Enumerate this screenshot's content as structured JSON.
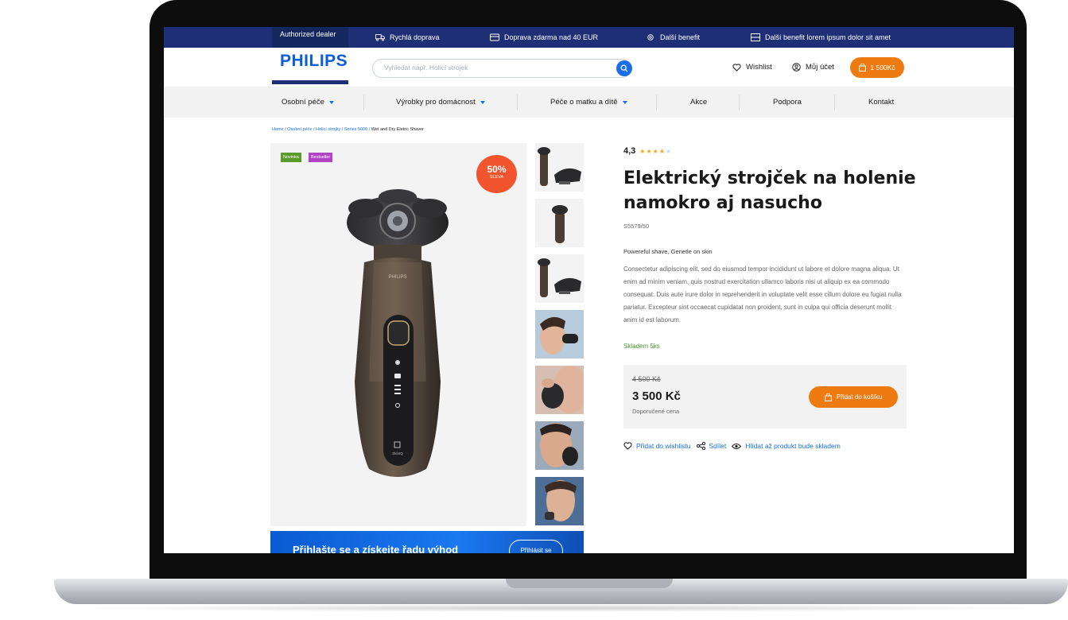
{
  "topbar": {
    "dealer": "Authorized dealer",
    "items": [
      "Rychlá doprava",
      "Doprava zdarma nad 40 EUR",
      "Další benefit",
      "Další benefit lorem ipsum dolor sit amet"
    ]
  },
  "header": {
    "logo": "PHILIPS",
    "search_placeholder": "Vyhledat např. Holicí strojek",
    "wishlist": "Wishlist",
    "account": "Můj účet",
    "cart": "1 500Kč"
  },
  "nav": [
    "Osobní péče",
    "Výrobky pro domácnost",
    "Péče o matku a dítě",
    "Akce",
    "Podpora",
    "Kontakt"
  ],
  "breadcrumb": {
    "links": [
      "Home",
      "Osobní péče",
      "Holicí strojky",
      "Series 5000"
    ],
    "current": "Wet and Dry Eletric Shaver"
  },
  "product": {
    "badges": [
      "Novinka",
      "Bestseller"
    ],
    "discount_pct": "50%",
    "discount_label": "SLEVA",
    "rating": "4,3",
    "rating_value": 4.3,
    "stars": "★★★★",
    "star_empty": "★",
    "title": "Elektrický strojček na holenie namokro aj nasucho",
    "sku": "S5579/50",
    "subtitle": "Powereful shave, Genetle on skin",
    "description": "Consectetur adipiscing elit, sed do eiusmod tempor incididunt ut labore et dolore magna aliqua. Ut enim ad minim veniam, quis nostrud exercitation ullamco laboris nisi ut aliquip ex ea commodo consequat. Duis aute irure dolor in reprehenderit in voluptate velit esse cillum dolore eu fugiat nulla pariatur. Excepteur sint occaecat cupidatat non proident, sunt in culpa qui officia deserunt mollit anim id est laborum.",
    "stock": "Skladem 5ks",
    "old_price": "4 500 Kč",
    "price": "3 500 Kč",
    "price_note": "Doporučené cena",
    "add_to_cart": "Přidat do košíku",
    "shaver_brand": "PHILIPS",
    "shaver_label": "SkinIQ"
  },
  "actions": {
    "wishlist": "Přidat do wishlistu",
    "share": "Sdílet",
    "watch": "Hlídat až produkt bude skladem"
  },
  "login_banner": {
    "text": "Přihlašte se a získejte řadu výhod",
    "button": "Přihlásit se"
  },
  "colors": {
    "navy": "#1f2f75",
    "blue": "#1a6ee6",
    "orange": "#ee7a12",
    "red": "#f2542d",
    "green_badge": "#5a9a2a",
    "purple_badge": "#b044c4"
  }
}
